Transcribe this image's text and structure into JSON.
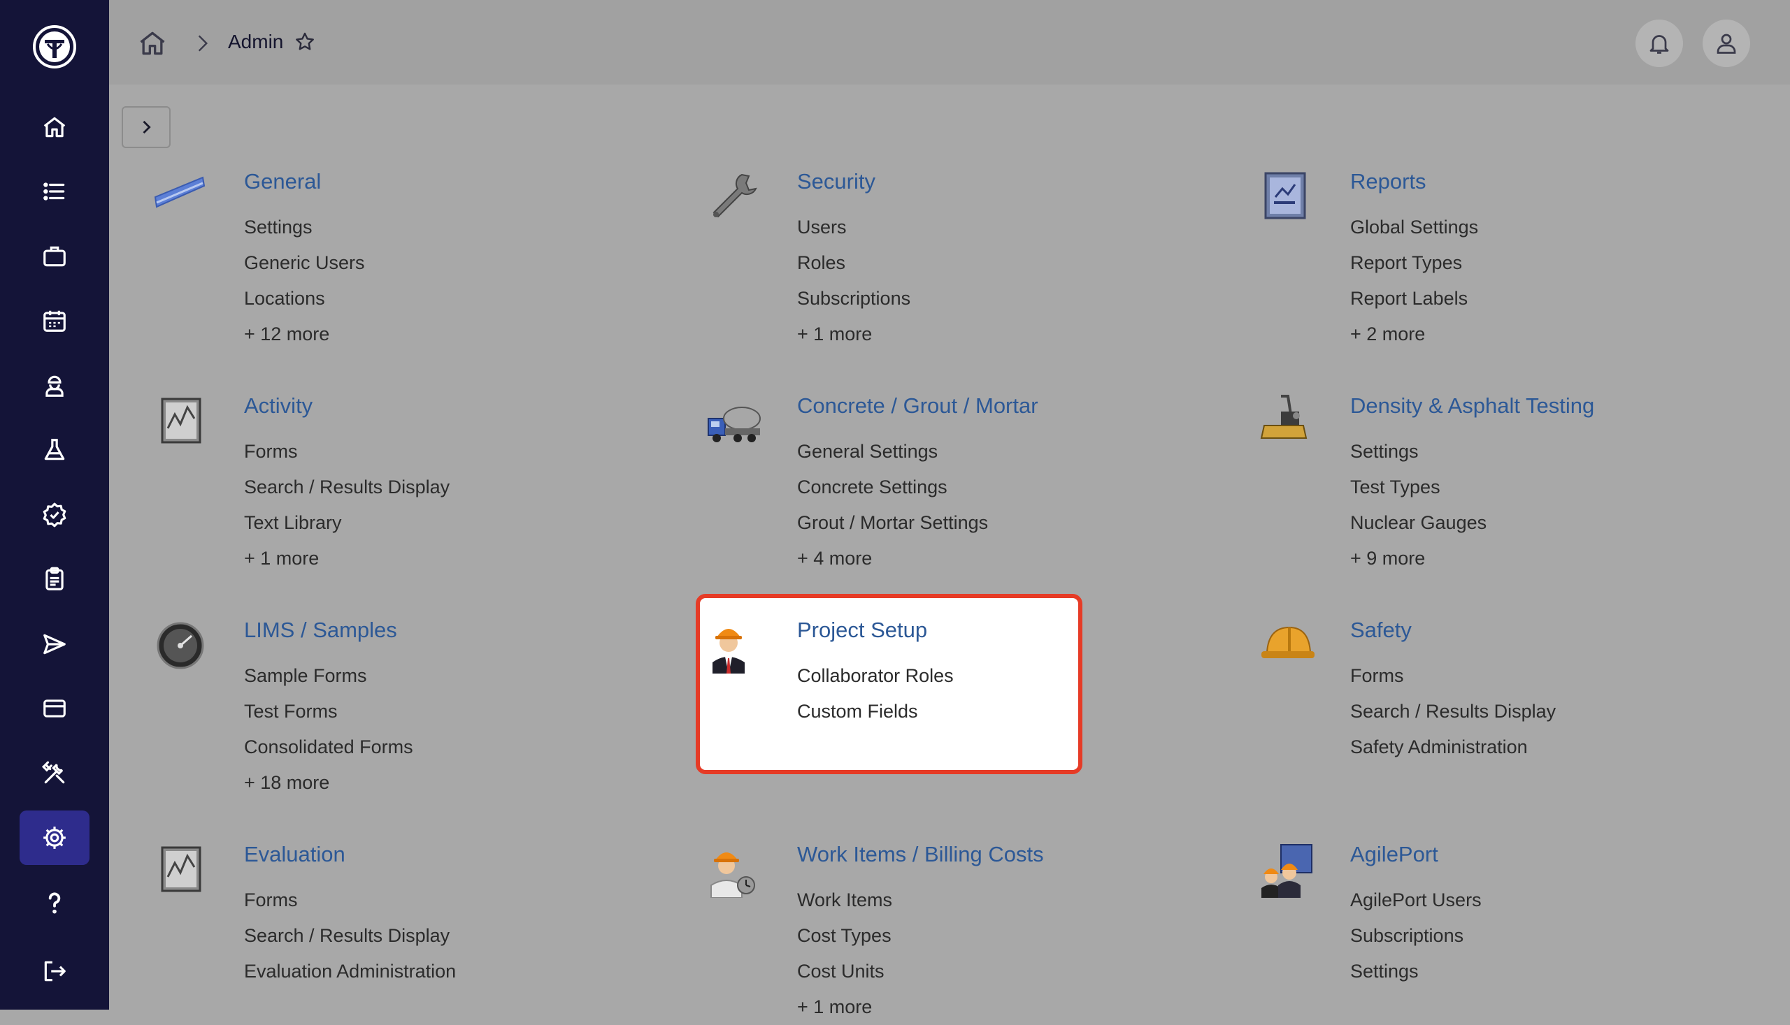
{
  "breadcrumb": {
    "title": "Admin"
  },
  "sidebar": {
    "items": [
      {
        "name": "home",
        "icon": "home-icon"
      },
      {
        "name": "list",
        "icon": "list-icon"
      },
      {
        "name": "projects",
        "icon": "briefcase-icon"
      },
      {
        "name": "calendar",
        "icon": "calendar-icon"
      },
      {
        "name": "people",
        "icon": "worker-icon"
      },
      {
        "name": "lab",
        "icon": "flask-icon"
      },
      {
        "name": "approvals",
        "icon": "badge-check-icon"
      },
      {
        "name": "reports",
        "icon": "clipboard-icon"
      },
      {
        "name": "send",
        "icon": "send-icon"
      },
      {
        "name": "billing",
        "icon": "credit-card-icon"
      },
      {
        "name": "tools",
        "icon": "tools-icon"
      },
      {
        "name": "settings",
        "icon": "gear-icon"
      },
      {
        "name": "help",
        "icon": "help-icon"
      },
      {
        "name": "logout",
        "icon": "logout-icon"
      }
    ]
  },
  "sections": [
    {
      "title": "General",
      "icon": "ruler-icon",
      "links": [
        "Settings",
        "Generic Users",
        "Locations",
        "+ 12 more"
      ]
    },
    {
      "title": "Security",
      "icon": "wrench-icon",
      "links": [
        "Users",
        "Roles",
        "Subscriptions",
        "+ 1 more"
      ]
    },
    {
      "title": "Reports",
      "icon": "report-icon",
      "links": [
        "Global Settings",
        "Report Types",
        "Report Labels",
        "+ 2 more"
      ]
    },
    {
      "title": "Activity",
      "icon": "chart-panel-icon",
      "links": [
        "Forms",
        "Search / Results Display",
        "Text Library",
        "+ 1 more"
      ]
    },
    {
      "title": "Concrete / Grout / Mortar",
      "icon": "concrete-truck-icon",
      "links": [
        "General Settings",
        "Concrete Settings",
        "Grout / Mortar Settings",
        "+ 4 more"
      ]
    },
    {
      "title": "Density & Asphalt Testing",
      "icon": "compactor-icon",
      "links": [
        "Settings",
        "Test Types",
        "Nuclear Gauges",
        "+ 9 more"
      ]
    },
    {
      "title": "LIMS / Samples",
      "icon": "gauge-icon",
      "links": [
        "Sample Forms",
        "Test Forms",
        "Consolidated Forms",
        "+ 18 more"
      ]
    },
    {
      "title": "Project Setup",
      "icon": "engineer-icon",
      "links": [
        "Collaborator Roles",
        "Custom Fields"
      ]
    },
    {
      "title": "Safety",
      "icon": "hard-hat-icon",
      "links": [
        "Forms",
        "Search / Results Display",
        "Safety Administration"
      ]
    },
    {
      "title": "Evaluation",
      "icon": "chart-panel-icon",
      "links": [
        "Forms",
        "Search / Results Display",
        "Evaluation Administration"
      ]
    },
    {
      "title": "Work Items / Billing Costs",
      "icon": "worker-clock-icon",
      "links": [
        "Work Items",
        "Cost Types",
        "Cost Units",
        "+ 1 more"
      ]
    },
    {
      "title": "AgilePort",
      "icon": "team-icon",
      "links": [
        "AgilePort Users",
        "Subscriptions",
        "Settings"
      ]
    }
  ]
}
